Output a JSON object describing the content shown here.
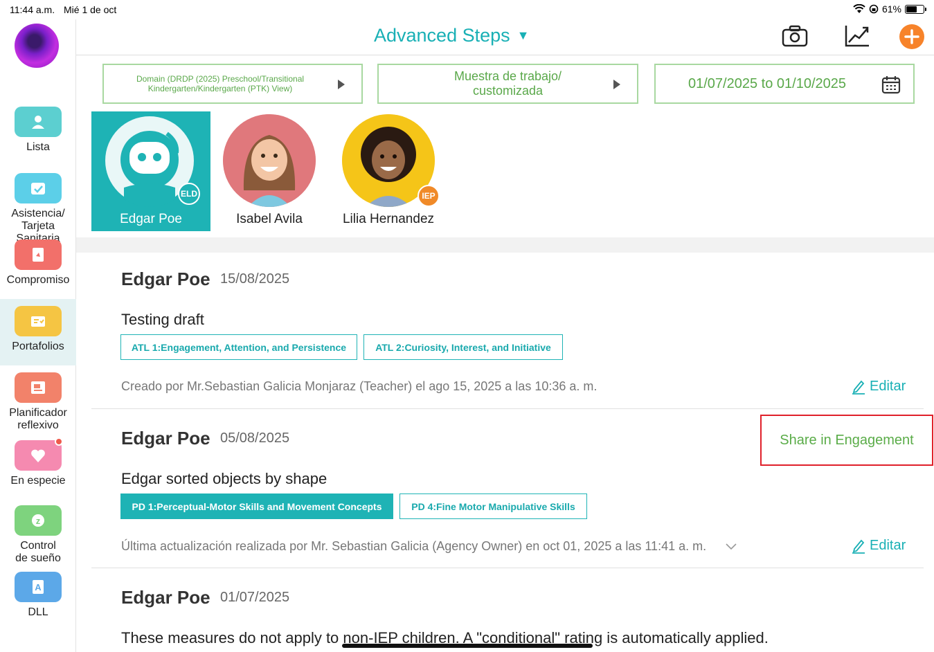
{
  "status": {
    "time": "11:44 a.m.",
    "date": "Mié 1 de oct",
    "battery": "61%",
    "battery_level": 0.61
  },
  "sidebar": {
    "items": [
      {
        "label": "Lista",
        "color": "#5ccfd0",
        "icon": "user-card-icon"
      },
      {
        "label": "Asistencia/\nTarjeta Sanitaria",
        "color": "#5ccfe8",
        "icon": "calendar-check-icon"
      },
      {
        "label": "Compromiso",
        "color": "#f2706a",
        "icon": "engagement-book-icon"
      },
      {
        "label": "Portafolios",
        "color": "#f5c543",
        "icon": "portfolio-icon",
        "active": true
      },
      {
        "label": "Planificador\nreflexivo",
        "color": "#f2826a",
        "icon": "planner-icon"
      },
      {
        "label": "En especie",
        "color": "#f58ab0",
        "icon": "heart-icon",
        "notification": true
      },
      {
        "label": "Control\nde sueño",
        "color": "#7ed37e",
        "icon": "sleep-icon"
      },
      {
        "label": "DLL",
        "color": "#5ca8e8",
        "icon": "language-icon"
      }
    ]
  },
  "header": {
    "title": "Advanced Steps",
    "colors": {
      "accent": "#19b0b5",
      "add": "#f7832a"
    }
  },
  "filters": {
    "domain": "Domain (DRDP (2025) Preschool/Transitional Kindergarten/Kindergarten (PTK) View)",
    "sample": "Muestra de trabajo/ customizada",
    "date_range": "01/07/2025 to 01/10/2025"
  },
  "children": [
    {
      "name": "Edgar Poe",
      "badge": "ELD",
      "selected": true
    },
    {
      "name": "Isabel Avila"
    },
    {
      "name": "Lilia Hernandez",
      "badge": "IEP"
    }
  ],
  "entries": [
    {
      "name": "Edgar Poe",
      "date": "15/08/2025",
      "title": "Testing draft",
      "tags": [
        "ATL 1:Engagement, Attention, and Persistence",
        "ATL 2:Curiosity, Interest, and Initiative"
      ],
      "meta": "Creado por Mr.Sebastian Galicia Monjaraz (Teacher) el ago 15, 2025 a las 10:36 a. m.",
      "edit": "Editar"
    },
    {
      "name": "Edgar Poe",
      "date": "05/08/2025",
      "title": "Edgar sorted objects by shape",
      "tags": [
        "PD 1:Perceptual-Motor Skills and Movement Concepts",
        "PD 4:Fine Motor Manipulative Skills"
      ],
      "meta": "Última actualización realizada por Mr. Sebastian Galicia (Agency Owner) en oct 01, 2025 a las 11:41 a. m.",
      "edit": "Editar",
      "share": "Share in Engagement"
    },
    {
      "name": "Edgar Poe",
      "date": "01/07/2025",
      "title": "These measures do not apply to non-IEP children. A \"conditional\" rating is automatically applied."
    }
  ]
}
